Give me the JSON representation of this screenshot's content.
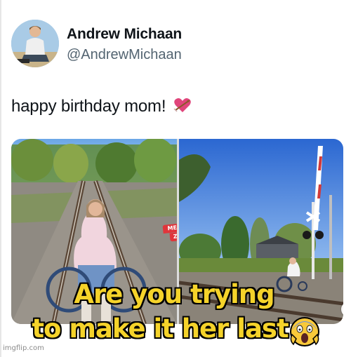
{
  "tweet": {
    "display_name": "Andrew Michaan",
    "handle": "@AndrewMichaan",
    "text": "happy birthday mom!",
    "text_emoji": "heart-with-arrow"
  },
  "media": {
    "photo_count": 2,
    "watermark_top": "MEME",
    "watermark_bottom": "ZAR",
    "next_icon": "chevron-right-icon"
  },
  "meme_caption": {
    "line1": "Are you trying",
    "line2": "to make it her last",
    "emoji": "face-screaming-in-fear"
  },
  "footer": {
    "credit": "imgflip.com"
  },
  "colors": {
    "caption_fill": "#f5d32a",
    "caption_stroke": "#000000",
    "handle_gray": "#536471",
    "text_dark": "#0f1419"
  }
}
